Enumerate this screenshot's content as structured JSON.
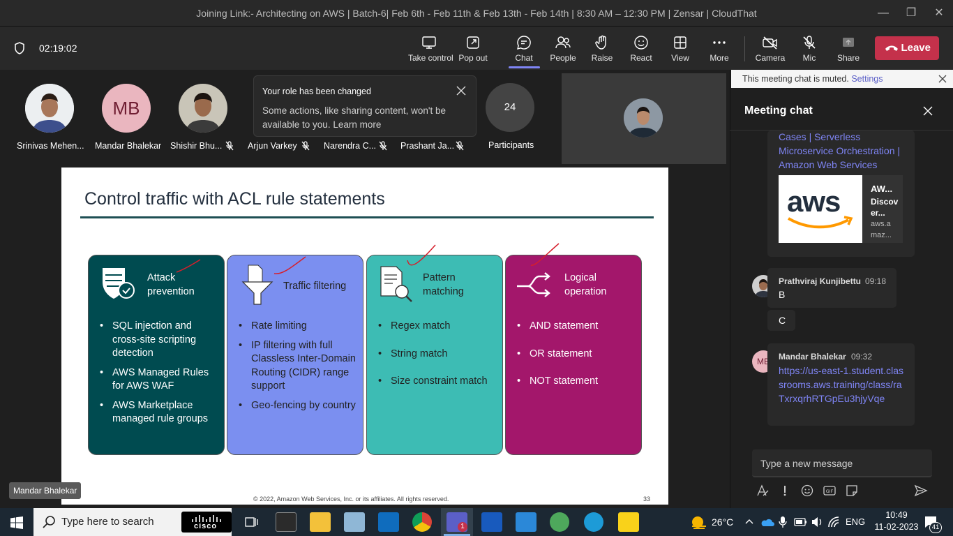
{
  "window": {
    "title": "Joining Link:- Architecting on AWS | Batch-6| Feb 6th - Feb 11th & Feb 13th - Feb 14th | 8:30 AM – 12:30 PM | Zensar | CloudThat"
  },
  "toolbar": {
    "timer": "02:19:02",
    "buttons": {
      "take_control": "Take control",
      "pop_out": "Pop out",
      "chat": "Chat",
      "people": "People",
      "raise": "Raise",
      "react": "React",
      "view": "View",
      "more": "More",
      "camera": "Camera",
      "mic": "Mic",
      "share": "Share"
    },
    "leave": "Leave"
  },
  "participants": [
    {
      "name": "Srinivas Mehen...",
      "type": "photo"
    },
    {
      "name": "Mandar Bhalekar",
      "initials": "MB"
    },
    {
      "name": "Shishir Bhu...",
      "type": "photo",
      "muted": true
    },
    {
      "name": "Arjun Varkey",
      "muted": true
    },
    {
      "name": "Narendra C...",
      "muted": true
    },
    {
      "name": "Prashant Ja...",
      "muted": true
    }
  ],
  "participant_count": {
    "value": "24",
    "label": "Participants"
  },
  "toast": {
    "title": "Your role has been changed",
    "body": "Some actions, like sharing content, won't be available to you. Learn more"
  },
  "slide": {
    "title": "Control traffic with ACL rule statements",
    "cards": [
      {
        "title": "Attack prevention",
        "color": "#004b50",
        "items": [
          "SQL injection and cross-site scripting detection",
          "AWS Managed Rules for AWS WAF",
          "AWS Marketplace managed rule groups"
        ]
      },
      {
        "title": "Traffic filtering",
        "color": "#7b8ff0",
        "items": [
          "Rate limiting",
          "IP filtering with full Classless Inter-Domain Routing (CIDR) range support",
          "Geo-fencing by country"
        ]
      },
      {
        "title": "Pattern matching",
        "color": "#3dbcb4",
        "items": [
          "Regex match",
          "String match",
          "Size constraint match"
        ]
      },
      {
        "title": "Logical operation",
        "color": "#a3176b",
        "items": [
          "AND statement",
          "OR statement",
          "NOT statement"
        ]
      }
    ],
    "copyright": "© 2022, Amazon Web Services, Inc. or its affiliates. All rights reserved.",
    "page_number": "33"
  },
  "presenter": "Mandar Bhalekar",
  "chat": {
    "muted_notice": "This meeting chat is muted.",
    "muted_settings": "Settings",
    "header": "Meeting chat",
    "link_preview": {
      "link_text": "Cases | Serverless Microservice Orchestration | Amazon Web Services",
      "logo_text": "aws",
      "card_title": "AW...",
      "card_desc": "Discov er...",
      "card_domain": "aws.a maz..."
    },
    "messages": [
      {
        "author": "Prathviraj Kunjibettu",
        "time": "09:18",
        "lines": [
          "B",
          "C"
        ]
      },
      {
        "author": "Mandar Bhalekar",
        "initials": "MB",
        "time": "09:32",
        "link": "https://us-east-1.student.classrooms.aws.training/class/raTxrxqrhRTGpEu3hjyVqe"
      }
    ],
    "input_placeholder": "Type a new message"
  },
  "taskbar": {
    "search_placeholder": "Type here to search",
    "cisco": "cisco",
    "weather": "26°C",
    "language": "ENG",
    "time": "10:49",
    "date": "11-02-2023",
    "notifications": "41",
    "teams_badge": "1"
  }
}
